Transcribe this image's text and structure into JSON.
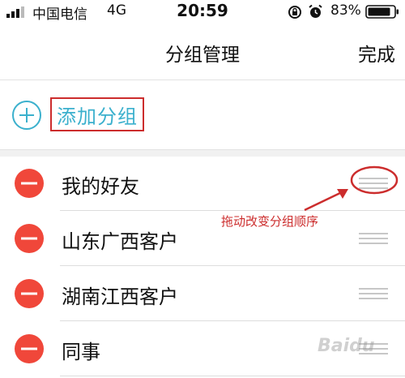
{
  "status_bar": {
    "carrier": "中国电信",
    "network": "4G",
    "time": "20:59",
    "battery_percent": "83%"
  },
  "nav": {
    "title": "分组管理",
    "done_label": "完成"
  },
  "add_group": {
    "label": "添加分组"
  },
  "groups": [
    {
      "name": "我的好友"
    },
    {
      "name": "山东广西客户"
    },
    {
      "name": "湖南江西客户"
    },
    {
      "name": "同事"
    }
  ],
  "annotation": {
    "text": "拖动改变分组顺序"
  },
  "watermark": {
    "text": "Baidu"
  },
  "colors": {
    "delete_red": "#f0473a",
    "add_accent": "#3bb0cd",
    "annotation_red": "#cc2d2d",
    "handle_gray": "#c7c7c7"
  },
  "icons": {
    "signal": "signal-bars-icon",
    "lock": "rotation-lock-icon",
    "alarm": "alarm-clock-icon",
    "battery": "battery-icon",
    "add": "plus-circle-icon",
    "delete": "minus-circle-icon",
    "drag": "drag-handle-icon"
  }
}
